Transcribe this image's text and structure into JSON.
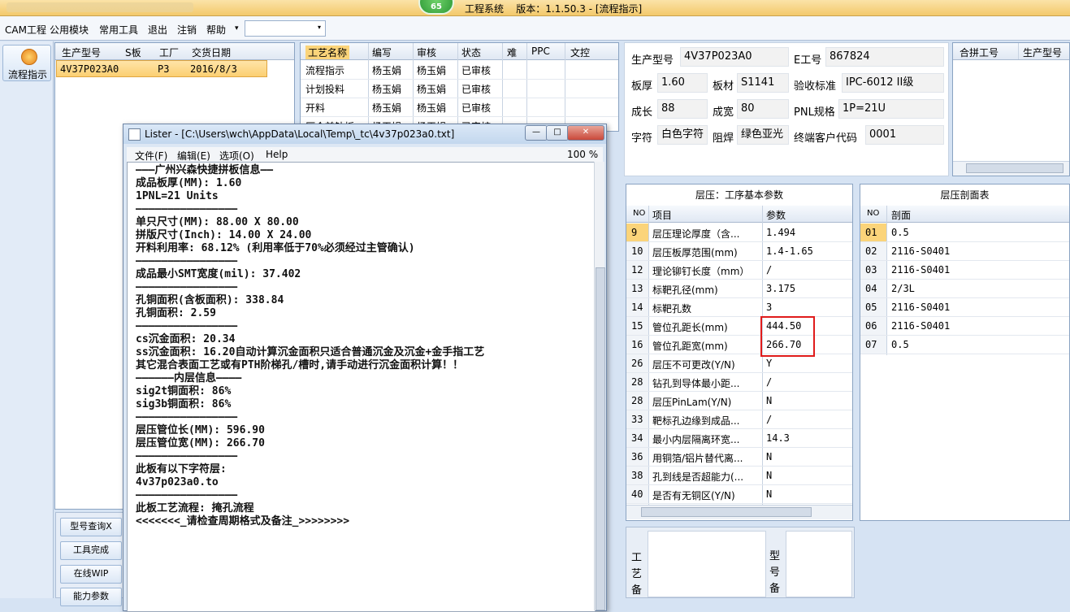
{
  "titlebar": {
    "badge": "65",
    "title": "工程系统    版本：1.1.50.3 - [流程指示]"
  },
  "menubar": {
    "items": [
      "CAM工程",
      "公用模块",
      "常用工具",
      "退出",
      "注销",
      "帮助"
    ],
    "help_arrow": "▾",
    "combo_value": "",
    "combo_arrow": "▾"
  },
  "leftbar": {
    "flow_label": "流程指示"
  },
  "order_grid": {
    "headers": [
      "生产型号",
      "S板",
      "工厂",
      "交货日期"
    ],
    "rows": [
      [
        "4V37P023A0",
        "",
        "P3",
        "2016/8/3"
      ]
    ]
  },
  "process_grid": {
    "headers": [
      "工艺名称",
      "编写",
      "审核",
      "状态",
      "难",
      "PPC",
      "文控"
    ],
    "rows": [
      [
        "流程指示",
        "杨玉娟",
        "杨玉娟",
        "已审核"
      ],
      [
        "计划投料",
        "杨玉娟",
        "杨玉娟",
        "已审核"
      ],
      [
        "开料",
        "杨玉娟",
        "杨玉娟",
        "已审核"
      ],
      [
        "压合前钻板",
        "杨玉娟",
        "杨玉娟",
        "已审核"
      ]
    ]
  },
  "side_buttons": [
    "型号查询X",
    "工具完成",
    "在线WIP",
    "能力参数"
  ],
  "info": {
    "prod_model_label": "生产型号",
    "prod_model": "4V37P023A0",
    "e_no_label": "E工号",
    "e_no": "867824",
    "thick_label": "板厚",
    "thick": "1.60",
    "material_label": "板材",
    "material": "S1141",
    "std_label": "验收标准",
    "std": "IPC-6012 II级",
    "len_label": "成长",
    "len": "88",
    "wid_label": "成宽",
    "wid": "80",
    "pnl_label": "PNL规格",
    "pnl": "1P=21U",
    "char_label": "字符",
    "char": "白色字符",
    "mask_label": "阻焊",
    "mask": "绿色亚光",
    "cust_label": "终端客户代码",
    "cust": "0001"
  },
  "merge_grid": {
    "headers": [
      "合拼工号",
      "生产型号"
    ]
  },
  "lam_params": {
    "title": "层压：工序基本参数",
    "headers": [
      "NO",
      "项目",
      "参数"
    ],
    "rows": [
      [
        "9",
        "层压理论厚度（含...",
        "1.494"
      ],
      [
        "10",
        "层压板厚范围(mm)",
        "1.4-1.65"
      ],
      [
        "12",
        "理论铆钉长度（mm）",
        "/"
      ],
      [
        "13",
        "标靶孔径(mm)",
        "3.175"
      ],
      [
        "14",
        "标靶孔数",
        "3"
      ],
      [
        "15",
        "管位孔距长(mm)",
        "444.50"
      ],
      [
        "16",
        "管位孔距宽(mm)",
        "266.70"
      ],
      [
        "26",
        "层压不可更改(Y/N)",
        "Y"
      ],
      [
        "28",
        "钻孔到导体最小距...",
        "/"
      ],
      [
        "28",
        "层压PinLam(Y/N)",
        "N"
      ],
      [
        "33",
        "靶标孔边缘到成品...",
        "/"
      ],
      [
        "34",
        "最小内层隔离环宽...",
        "14.3"
      ],
      [
        "36",
        "用铜箔/铝片替代离...",
        "N"
      ],
      [
        "38",
        "孔到线是否超能力(...",
        "N"
      ],
      [
        "40",
        "是否有无铜区(Y/N)",
        "N"
      ]
    ]
  },
  "lam_section": {
    "title": "层压剖面表",
    "headers": [
      "NO",
      "剖面"
    ],
    "rows": [
      [
        "01",
        "0.5"
      ],
      [
        "02",
        "2116-S0401"
      ],
      [
        "03",
        "2116-S0401"
      ],
      [
        "04",
        "2/3L"
      ],
      [
        "05",
        "2116-S0401"
      ],
      [
        "06",
        "2116-S0401"
      ],
      [
        "07",
        "0.5"
      ]
    ]
  },
  "notes": {
    "process_note_label": "工\n艺\n备",
    "model_note_label": "型\n号\n备"
  },
  "lister": {
    "title": "Lister - [C:\\Users\\wch\\AppData\\Local\\Temp\\_tc\\4v37p023a0.txt]",
    "menu": [
      "文件(F)",
      "编辑(E)",
      "选项(O)",
      "Help"
    ],
    "zoom": "100 %",
    "lines": [
      "———广州兴森快捷拼板信息——",
      "成品板厚(MM): 1.60",
      "1PNL=21 Units",
      "————————————————",
      "单只尺寸(MM): 88.00 X 80.00",
      "拼版尺寸(Inch): 14.00 X 24.00",
      "开料利用率: 68.12% (利用率低于70%必须经过主管确认)",
      "————————————————",
      "成品最小SMT宽度(mil): 37.402",
      "————————————————",
      "孔铜面积(含板面积): 338.84",
      "孔铜面积: 2.59",
      "————————————————",
      "cs沉金面积: 20.34",
      "ss沉金面积: 16.20自动计算沉金面积只适合普通沉金及沉金+金手指工艺",
      "其它混合表面工艺或有PTH阶梯孔/槽时,请手动进行沉金面积计算！！",
      "——————内层信息————",
      "sig2t铜面积: 86%",
      "sig3b铜面积: 86%",
      "————————————————",
      "层压管位长(MM): 596.90",
      "层压管位宽(MM): 266.70",
      "————————————————",
      "此板有以下字符层:",
      "4v37p023a0.to",
      "————————————————",
      "此板工艺流程: 掩孔流程",
      "<<<<<<<_请检查周期格式及备注_>>>>>>>>"
    ]
  }
}
